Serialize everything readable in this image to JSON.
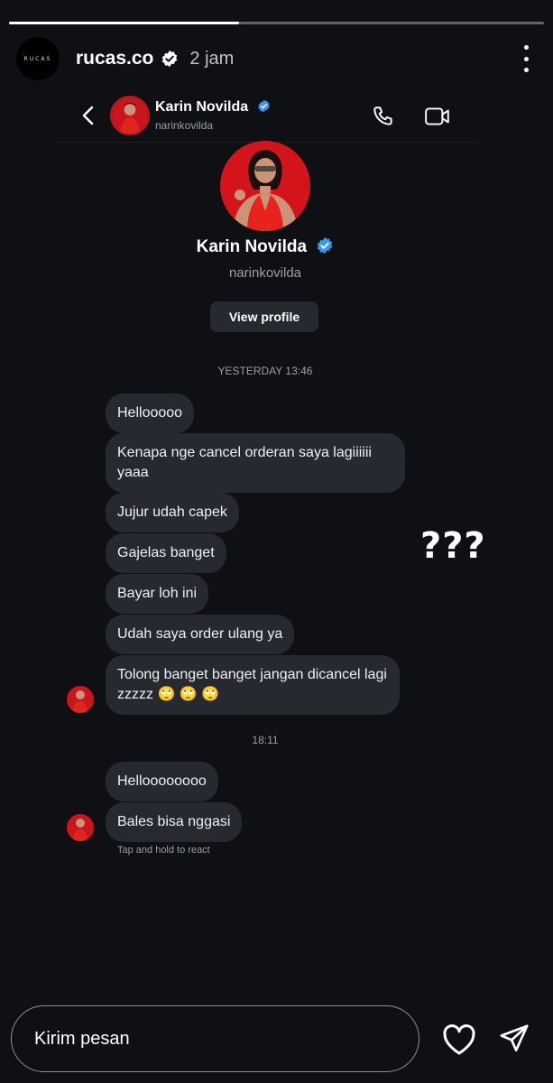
{
  "story": {
    "progress": 0.43,
    "avatar_text": "RUCAS",
    "username": "rucas.co",
    "time": "2 jam",
    "question_marks": "???"
  },
  "dm": {
    "header": {
      "name": "Karin Novilda",
      "handle": "narinkovilda"
    },
    "profile": {
      "name": "Karin Novilda",
      "handle": "narinkovilda",
      "view_profile_label": "View profile"
    },
    "timestamp_1": "YESTERDAY 13:46",
    "messages_1": [
      "Hellooooo",
      "Kenapa nge cancel orderan saya lagiiiiii yaaa",
      "Jujur udah capek",
      "Gajelas banget",
      "Bayar loh ini",
      "Udah saya order ulang ya",
      "Tolong banget banget jangan dicancel lagi zzzzz 🙄 🙄 🙄"
    ],
    "timestamp_2": "18:11",
    "messages_2": [
      "Helloooooooo",
      "Bales bisa nggasi"
    ],
    "react_hint": "Tap and hold to react"
  },
  "reply": {
    "placeholder": "Kirim pesan"
  },
  "colors": {
    "background": "#0e1014",
    "bubble": "#262a30",
    "verified_blue": "#3897f0"
  }
}
